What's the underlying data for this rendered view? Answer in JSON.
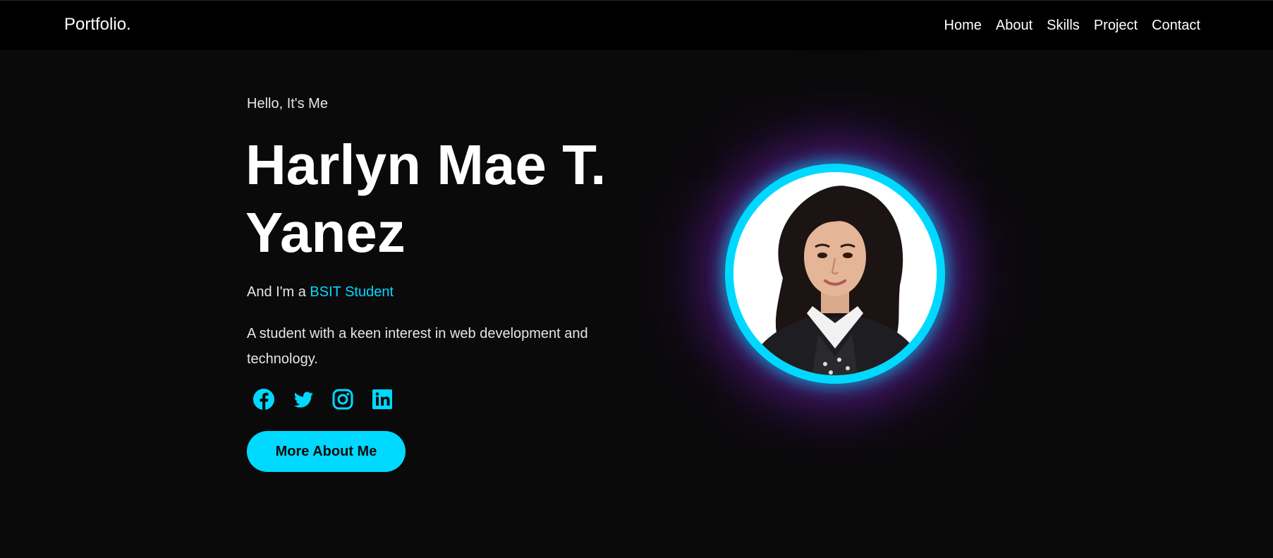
{
  "nav": {
    "logo": "Portfolio.",
    "links": [
      "Home",
      "About",
      "Skills",
      "Project",
      "Contact"
    ]
  },
  "hero": {
    "greeting": "Hello, It's Me",
    "name": "Harlyn Mae T. Yanez",
    "role_prefix": "And I'm a ",
    "role_highlight": "BSIT Student",
    "description": "A student with a keen interest in web development and technology.",
    "cta_label": "More About Me",
    "socials": [
      "facebook-icon",
      "twitter-icon",
      "instagram-icon",
      "linkedin-icon"
    ]
  },
  "colors": {
    "background": "#0a0a0a",
    "navbar": "#000000",
    "accent": "#00d9ff",
    "glow": "#7828c8"
  }
}
